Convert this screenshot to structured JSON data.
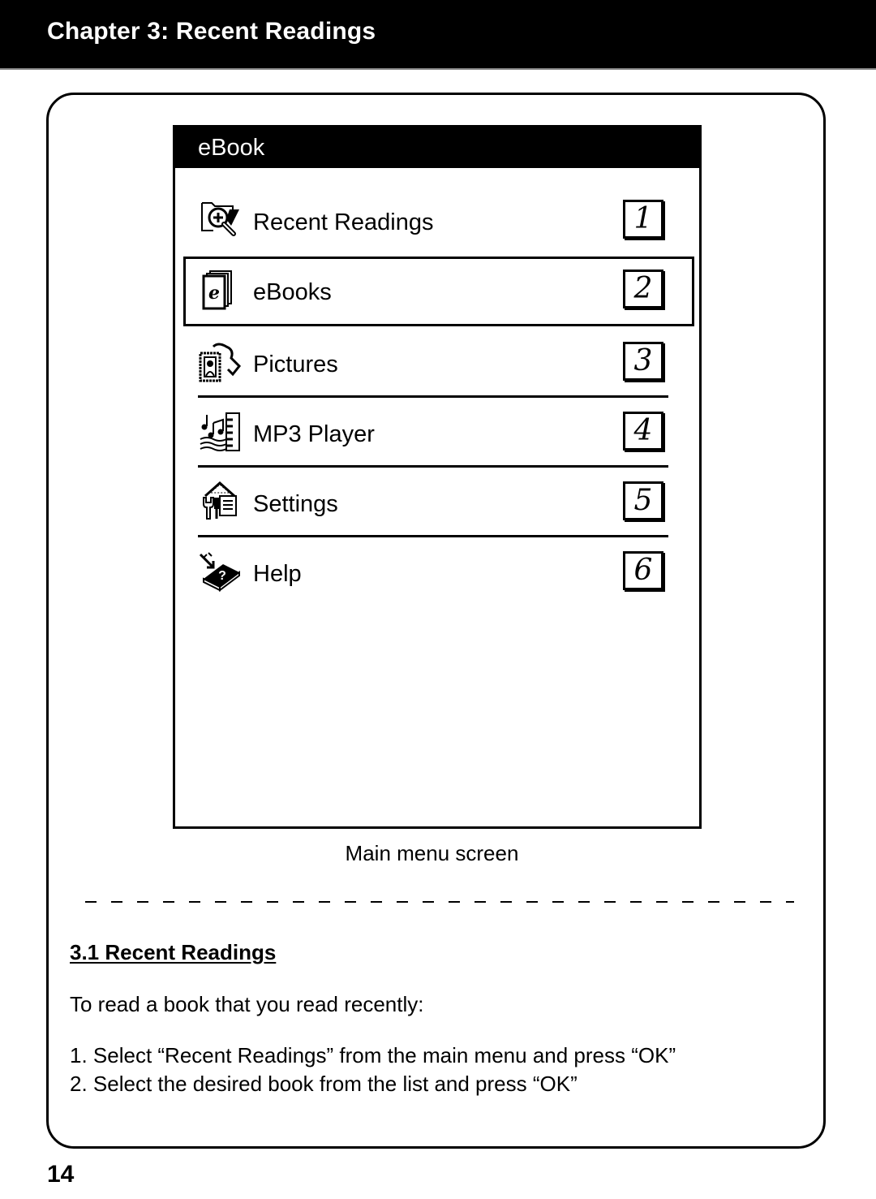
{
  "header": {
    "chapter_title": "Chapter 3: Recent Readings"
  },
  "device_screen": {
    "title": "eBook",
    "selected_index": 1,
    "menu_items": [
      {
        "label": "Recent Readings",
        "key": "1",
        "icon": "folder-magnifier-icon"
      },
      {
        "label": "eBooks",
        "key": "2",
        "icon": "book-stack-icon"
      },
      {
        "label": "Pictures",
        "key": "3",
        "icon": "picture-frame-icon"
      },
      {
        "label": "MP3 Player",
        "key": "4",
        "icon": "music-notes-piano-icon"
      },
      {
        "label": "Settings",
        "key": "5",
        "icon": "tools-settings-icon"
      },
      {
        "label": "Help",
        "key": "6",
        "icon": "help-book-icon"
      }
    ]
  },
  "caption": "Main menu screen",
  "section": {
    "title": "3.1 Recent Readings",
    "intro": "To read a book that you read recently:",
    "steps": [
      "1. Select “Recent Readings” from the main menu and press “OK”",
      "2. Select the desired book from the list and press “OK”"
    ]
  },
  "page_number": "14"
}
